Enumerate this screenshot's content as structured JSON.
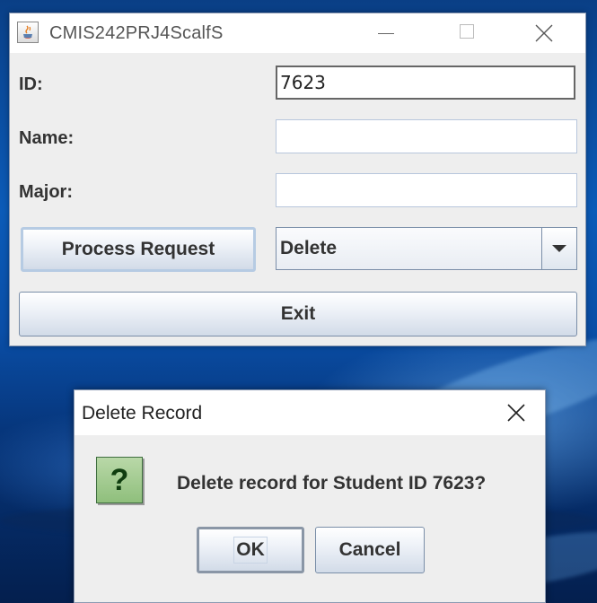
{
  "main_window": {
    "title": "CMIS242PRJ4ScalfS",
    "fields": {
      "id_label": "ID:",
      "id_value": "7623",
      "name_label": "Name:",
      "name_value": "",
      "major_label": "Major:",
      "major_value": ""
    },
    "process_button_label": "Process Request",
    "operation_combo": {
      "selected": "Delete"
    },
    "exit_button_label": "Exit"
  },
  "dialog": {
    "title": "Delete Record",
    "message": "Delete record for Student ID 7623?",
    "icon": "question-icon",
    "icon_glyph": "?",
    "ok_label": "OK",
    "cancel_label": "Cancel"
  },
  "colors": {
    "window_bg": "#eeeeee",
    "button_border": "#7a8ea8",
    "question_icon_green": "#8fbf7c",
    "desktop_blue": "#0b5bb8"
  }
}
